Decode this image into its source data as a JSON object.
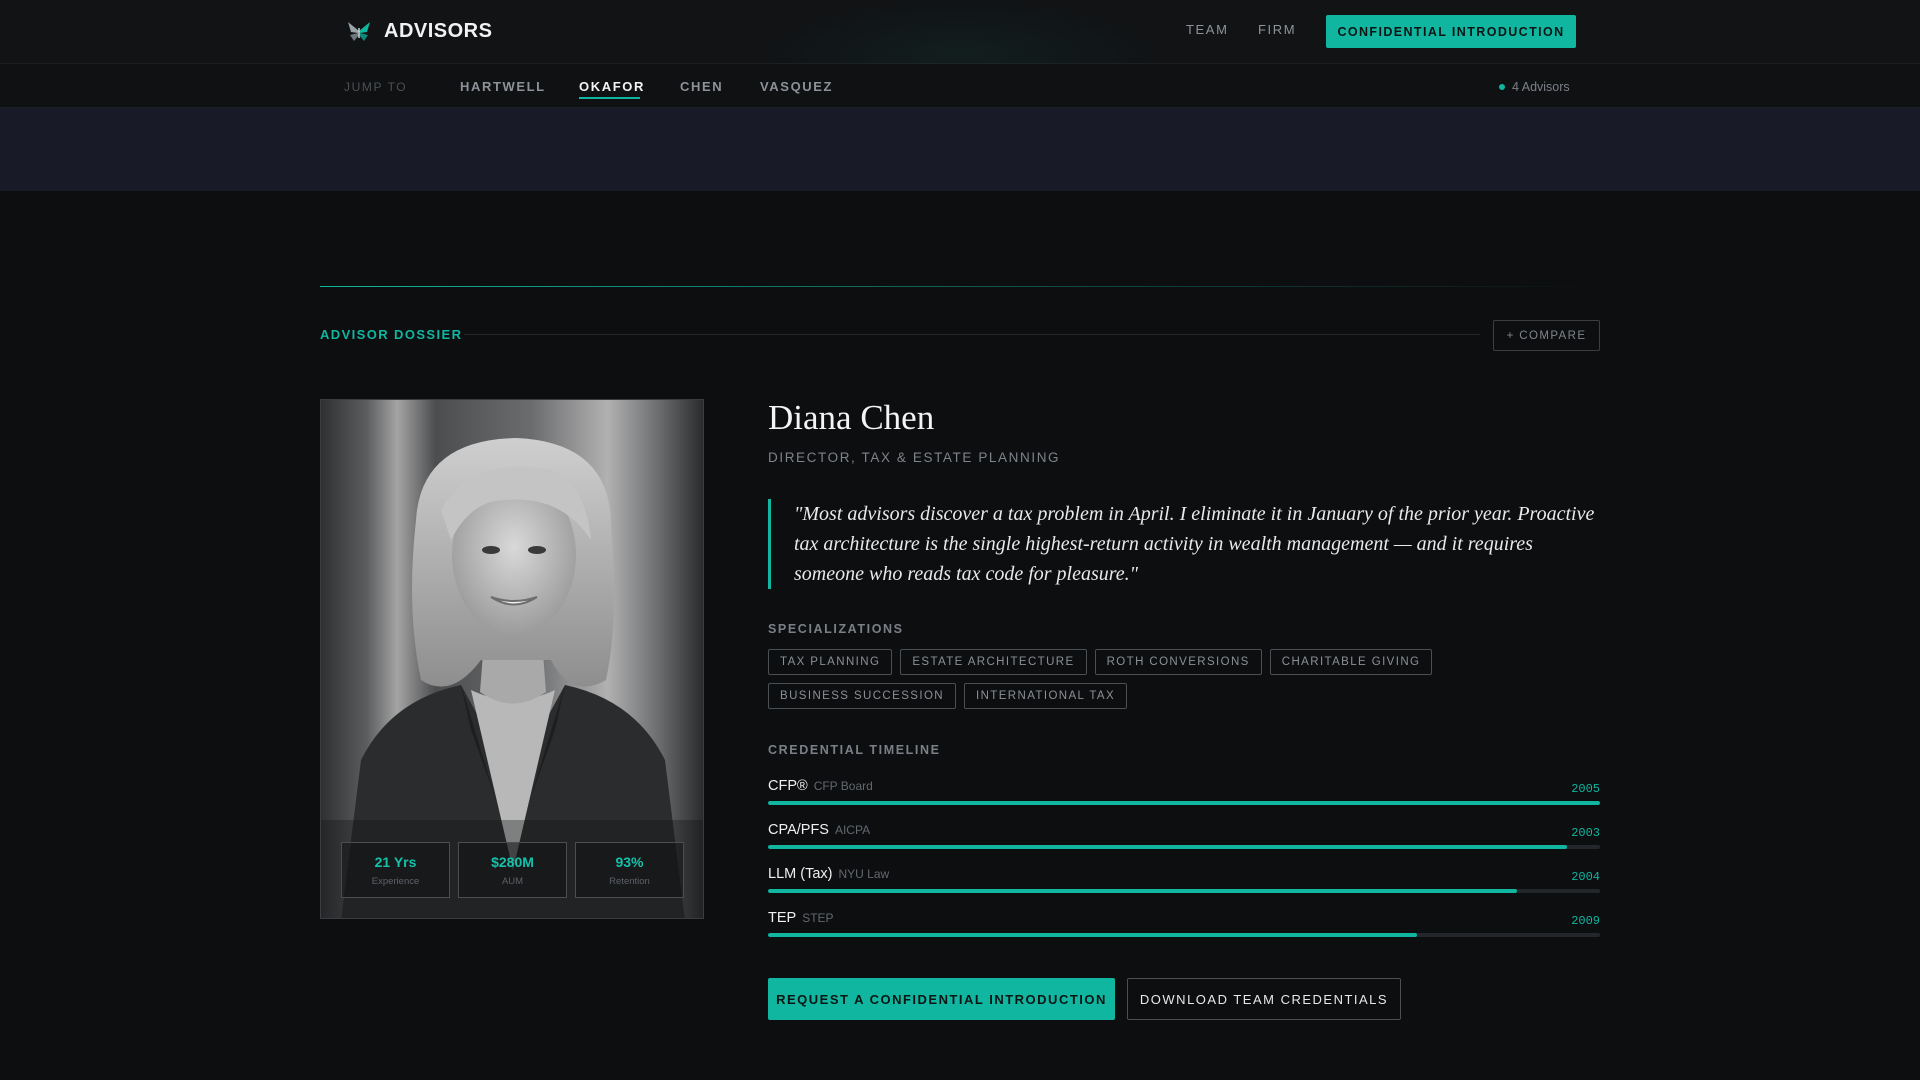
{
  "header": {
    "brand": "ADVISORS",
    "brand_icon": "butterfly-logo-icon",
    "nav": [
      "TEAM",
      "FIRM"
    ],
    "cta": "CONFIDENTIAL INTRODUCTION"
  },
  "subnav": {
    "jump_to": "JUMP TO",
    "items": [
      "HARTWELL",
      "OKAFOR",
      "CHEN",
      "VASQUEZ"
    ],
    "active": "OKAFOR",
    "count": "4 Advisors"
  },
  "section": {
    "label": "ADVISOR DOSSIER",
    "compare": "+ COMPARE"
  },
  "advisor": {
    "name": "Diana Chen",
    "role": "DIRECTOR, TAX & ESTATE PLANNING",
    "quote": "\"Most advisors discover a tax problem in April. I eliminate it in January of the prior year. Proactive tax architecture is the single highest-return activity in wealth management — and it requires someone who reads tax code for pleasure.\"",
    "stats": [
      {
        "value": "21 Yrs",
        "label": "Experience"
      },
      {
        "value": "$280M",
        "label": "AUM"
      },
      {
        "value": "93%",
        "label": "Retention"
      }
    ],
    "specializations_title": "SPECIALIZATIONS",
    "specializations": [
      "TAX PLANNING",
      "ESTATE ARCHITECTURE",
      "ROTH CONVERSIONS",
      "CHARITABLE GIVING",
      "BUSINESS SUCCESSION",
      "INTERNATIONAL TAX"
    ],
    "credentials_title": "CREDENTIAL TIMELINE",
    "credentials": [
      {
        "name": "CFP®",
        "org": "CFP Board",
        "year": "2005",
        "progress": 1.0
      },
      {
        "name": "CPA/PFS",
        "org": "AICPA",
        "year": "2003",
        "progress": 0.96
      },
      {
        "name": "LLM (Tax)",
        "org": "NYU Law",
        "year": "2004",
        "progress": 0.9
      },
      {
        "name": "TEP",
        "org": "STEP",
        "year": "2009",
        "progress": 0.78
      }
    ]
  },
  "actions": {
    "primary": "REQUEST A CONFIDENTIAL INTRODUCTION",
    "secondary": "DOWNLOAD TEAM CREDENTIALS"
  },
  "colors": {
    "accent": "#10b6a0",
    "background": "#0d0e10",
    "band": "#181a28"
  }
}
